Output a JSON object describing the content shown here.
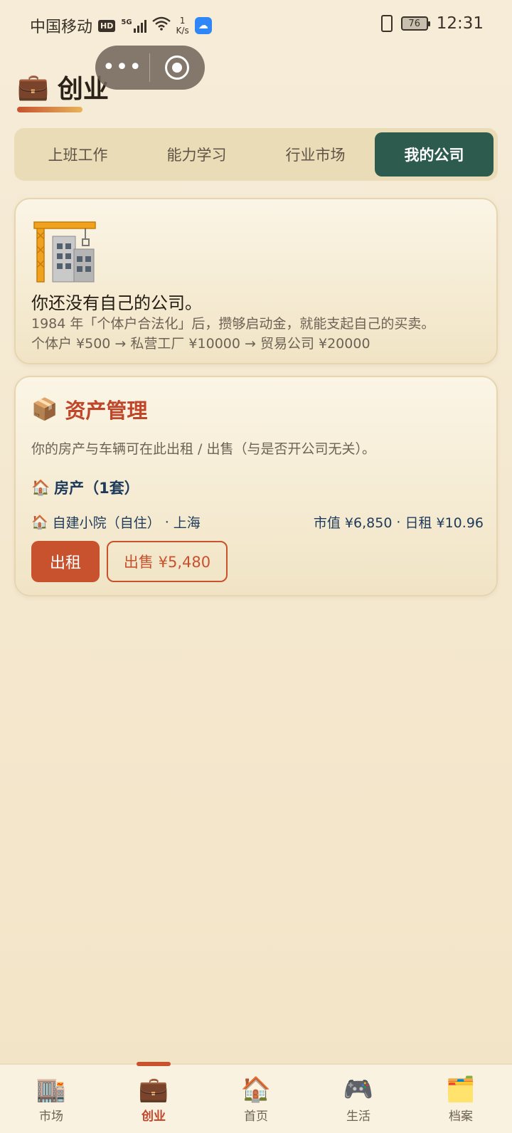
{
  "status_bar": {
    "carrier": "中国移动",
    "hd": "HD",
    "network": "5G",
    "speed_value": "1",
    "speed_unit": "K/s",
    "battery": "76",
    "time": "12:31"
  },
  "header": {
    "emoji": "💼",
    "title": "创业"
  },
  "tabs": [
    {
      "label": "上班工作",
      "active": false
    },
    {
      "label": "能力学习",
      "active": false
    },
    {
      "label": "行业市场",
      "active": false
    },
    {
      "label": "我的公司",
      "active": true
    }
  ],
  "company_card": {
    "icon": "construction-crane-building-icon",
    "message": "你还没有自己的公司。",
    "line1": "1984 年「个体户合法化」后，攒够启动金，就能支起自己的买卖。",
    "line2": "个体户 ¥500 → 私营工厂 ¥10000 → 贸易公司 ¥20000"
  },
  "asset_card": {
    "emoji": "📦",
    "title": "资产管理",
    "description": "你的房产与车辆可在此出租 / 出售（与是否开公司无关）。",
    "property_header_emoji": "🏠",
    "property_header": "房产（1套）",
    "property": {
      "emoji": "🏠",
      "name": "自建小院（自住）",
      "separator": "·",
      "city": "上海",
      "market_value": "市值 ¥6,850",
      "daily_rent": "日租 ¥10.96"
    },
    "rent_button": "出租",
    "sell_button": "出售 ¥5,480"
  },
  "bottom_nav": [
    {
      "icon": "🏬",
      "label": "市场",
      "active": false
    },
    {
      "icon": "💼",
      "label": "创业",
      "active": true
    },
    {
      "icon": "🏠",
      "label": "首页",
      "active": false
    },
    {
      "icon": "🎮",
      "label": "生活",
      "active": false
    },
    {
      "icon": "🗂️",
      "label": "档案",
      "active": false
    }
  ],
  "colors": {
    "accent": "#c8512e",
    "tab_active": "#2d5b4d",
    "navy_text": "#1e3a5b",
    "background": "#f4e8cf"
  }
}
